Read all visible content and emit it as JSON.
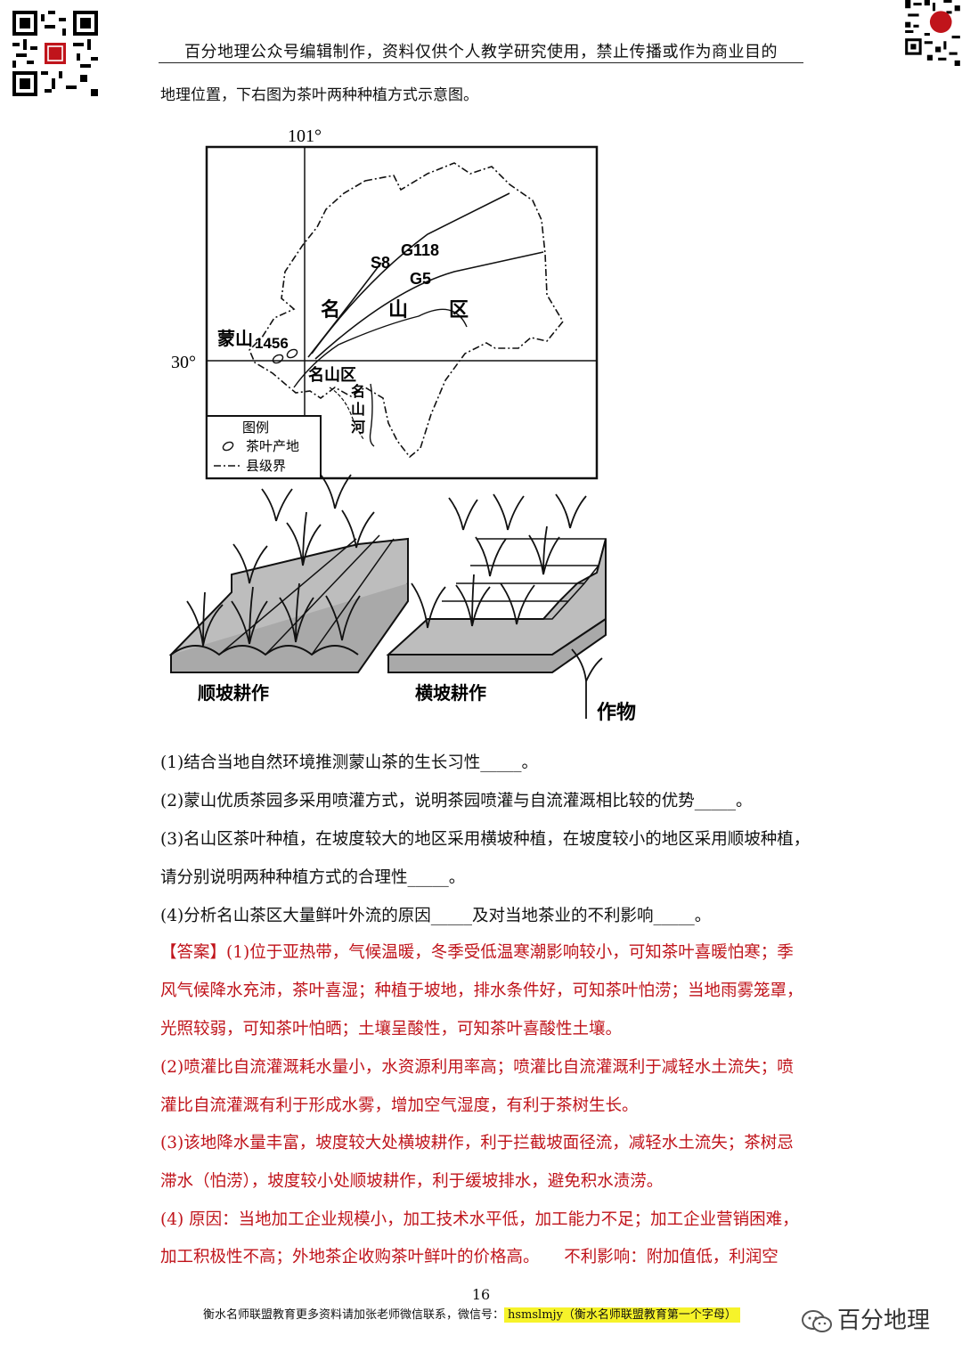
{
  "header": {
    "text": "百分地理公众号编辑制作，资料仅供个人教学研究使用，禁止传播或作为商业目的"
  },
  "intro": "地理位置，下右图为茶叶两种种植方式示意图。",
  "map": {
    "longitude_label": "101°",
    "latitude_label": "30°",
    "roads": [
      "G118",
      "S8",
      "G5"
    ],
    "region_label": [
      "名",
      "山",
      "区"
    ],
    "mountain_label": "蒙山",
    "elevation": "1456",
    "county_label": "名山区",
    "river_label": [
      "名",
      "山",
      "河"
    ],
    "legend_title": "图例",
    "legend_tea": "茶叶产地",
    "legend_boundary": "县级界"
  },
  "farming": {
    "down_slope": "顺坡耕作",
    "cross_slope": "横坡耕作",
    "crop": "作物"
  },
  "questions": {
    "q1": "(1)结合当地自然环境推测蒙山茶的生长习性_____。",
    "q2": "(2)蒙山优质茶园多采用喷灌方式，说明茶园喷灌与自流灌溉相比较的优势_____。",
    "q3a": "(3)名山区茶叶种植，在坡度较大的地区采用横坡种植，在坡度较小的地区采用顺坡种植，",
    "q3b": "请分别说明两种种植方式的合理性_____。",
    "q4": "(4)分析名山茶区大量鲜叶外流的原因_____及对当地茶业的不利影响_____。"
  },
  "answer": {
    "tag": "【答案】",
    "a1_l1": "(1)位于亚热带，气候温暖，冬季受低温寒潮影响较小，可知茶叶喜暖怕寒；季",
    "a1_l2": "风气候降水充沛，茶叶喜湿；种植于坡地，排水条件好，可知茶叶怕涝；当地雨雾笼罩，",
    "a1_l3": "光照较弱，可知茶叶怕晒；土壤呈酸性，可知茶叶喜酸性土壤。",
    "a2_l1": "(2)喷灌比自流灌溉耗水量小，水资源利用率高；喷灌比自流灌溉利于减轻水土流失；喷",
    "a2_l2": "灌比自流灌溉有利于形成水雾，增加空气湿度，有利于茶树生长。",
    "a3_l1": "(3)该地降水量丰富，坡度较大处横坡耕作，利于拦截坡面径流，减轻水土流失；茶树忌",
    "a3_l2": "滞水（怕涝），坡度较小处顺坡耕作，利于缓坡排水，避免积水渍涝。",
    "a4_l1": "(4) 原因：当地加工企业规模小，加工技术水平低，加工能力不足；加工企业营销困难，",
    "a4_l2": "加工积极性不高；外地茶企收购茶叶鲜叶的价格高。　　不利影响：附加值低，利润空"
  },
  "page_number": "16",
  "footer": {
    "text": "衡水名师联盟教育更多资料请加张老师微信联系，微信号：",
    "wechat": "hsmslmjy（衡水名师联盟教育第一个字母）"
  },
  "brand": "百分地理",
  "colors": {
    "answer_red": "#c0141b",
    "highlight_yellow": "#f6f32a"
  }
}
